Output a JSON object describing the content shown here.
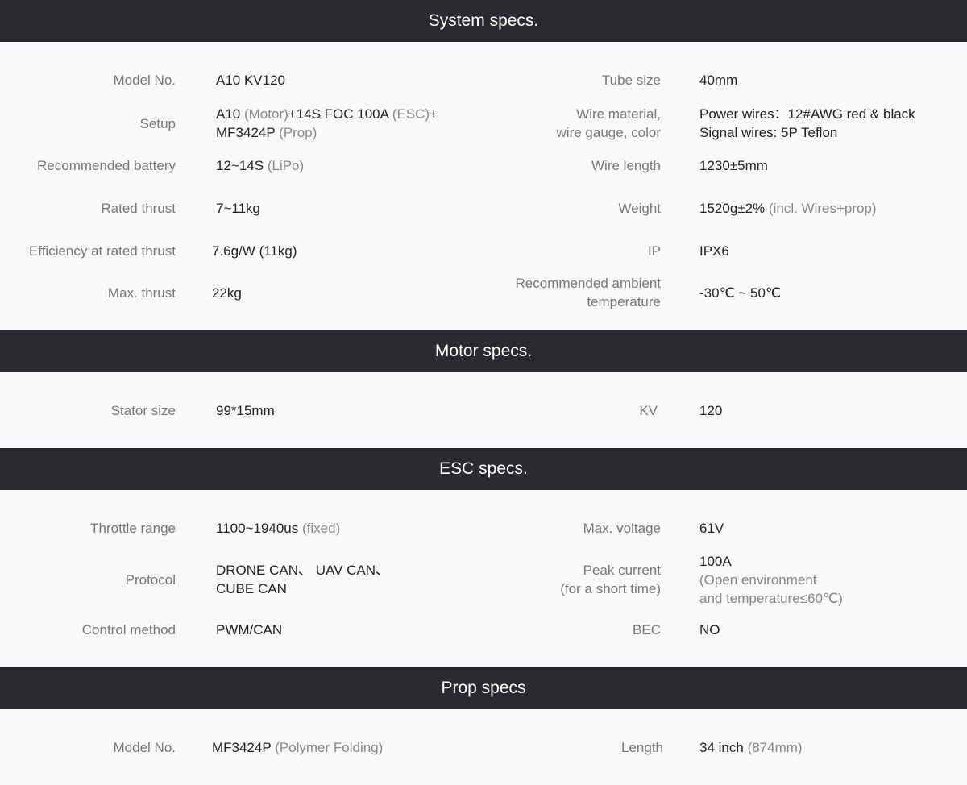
{
  "system": {
    "title": "System specs.",
    "model_no": {
      "label": "Model No.",
      "value": "A10 KV120"
    },
    "tube_size": {
      "label": "Tube size",
      "value": "40mm"
    },
    "setup": {
      "label": "Setup",
      "motor": "A10",
      "motor_note": "(Motor)",
      "esc": "+14S FOC 100A",
      "esc_note": "(ESC)",
      "plus": "+",
      "prop": "MF3424P",
      "prop_note": "(Prop)"
    },
    "wire_material": {
      "label_line1": "Wire material,",
      "label_line2": "wire gauge, color",
      "value_line1": "Power wires：12#AWG red & black",
      "value_line2": "Signal wires: 5P Teflon"
    },
    "battery": {
      "label": "Recommended battery",
      "value": "12~14S",
      "note": "(LiPo)"
    },
    "wire_length": {
      "label": "Wire length",
      "value": "1230±5mm"
    },
    "rated_thrust": {
      "label": "Rated thrust",
      "value": "7~11kg"
    },
    "weight": {
      "label": "Weight",
      "value": "1520g±2%",
      "note": "(incl. Wires+prop)"
    },
    "efficiency": {
      "label": "Efficiency at rated thrust",
      "value": "7.6g/W (11kg)"
    },
    "ip": {
      "label": "IP",
      "value": "IPX6"
    },
    "max_thrust": {
      "label": "Max. thrust",
      "value": "22kg"
    },
    "ambient_temp": {
      "label_line1": "Recommended ambient",
      "label_line2": "temperature",
      "value": "-30℃ ~ 50℃"
    }
  },
  "motor": {
    "title": "Motor specs.",
    "stator_size": {
      "label": "Stator size",
      "value": "99*15mm"
    },
    "kv": {
      "label": "KV",
      "value": "120"
    }
  },
  "esc": {
    "title": "ESC specs.",
    "throttle_range": {
      "label": "Throttle range",
      "value": "1100~1940us",
      "note": "(fixed)"
    },
    "max_voltage": {
      "label": "Max. voltage",
      "value": "61V"
    },
    "protocol": {
      "label": "Protocol",
      "value_line1": "DRONE CAN、 UAV CAN、",
      "value_line2": "CUBE CAN"
    },
    "peak_current": {
      "label_line1": "Peak current",
      "label_line2": "(for a short time)",
      "value": "100A",
      "note_line1": "(Open environment",
      "note_line2": "and temperature≤60℃)"
    },
    "control_method": {
      "label": "Control method",
      "value": "PWM/CAN"
    },
    "bec": {
      "label": "BEC",
      "value": "NO"
    }
  },
  "prop": {
    "title": "Prop specs",
    "model_no": {
      "label": "Model No.",
      "value": "MF3424P",
      "note": "(Polymer Folding)"
    },
    "length": {
      "label": "Length",
      "value": "34 inch",
      "note": "(874mm)"
    }
  }
}
